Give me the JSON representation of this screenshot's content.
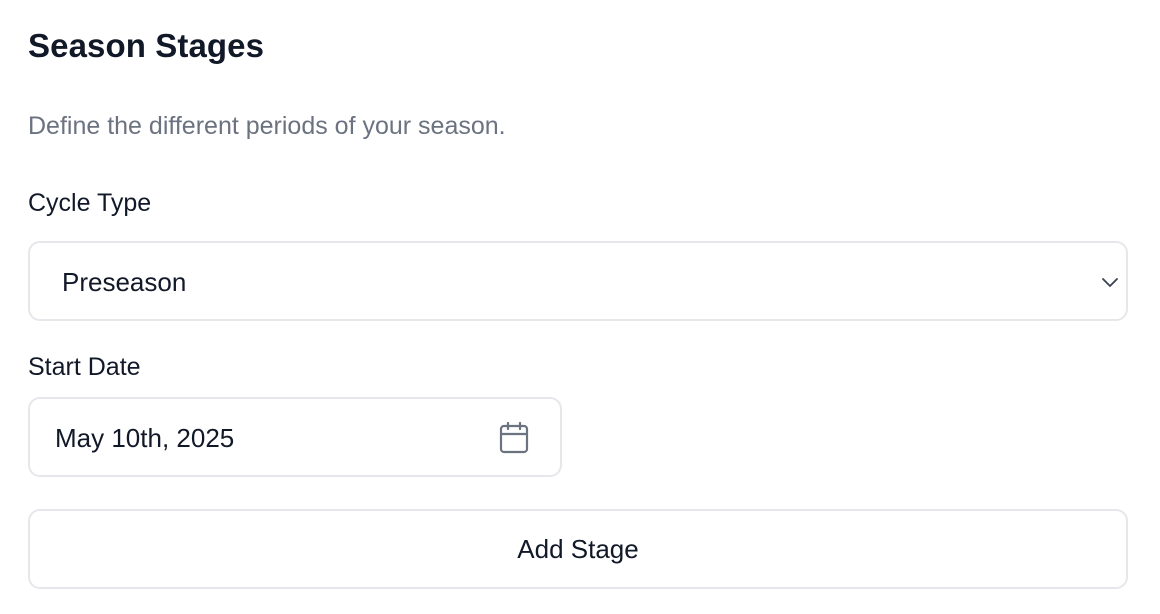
{
  "section": {
    "title": "Season Stages",
    "description": "Define the different periods of your season."
  },
  "cycle_type": {
    "label": "Cycle Type",
    "selected": "Preseason",
    "icon": "chevron-down-icon"
  },
  "start_date": {
    "label": "Start Date",
    "value": "May 10th, 2025",
    "icon": "calendar-icon"
  },
  "actions": {
    "add_stage_label": "Add Stage"
  },
  "colors": {
    "text_primary": "#111827",
    "text_muted": "#6b7280",
    "border": "#e5e7eb",
    "icon": "#6b7280"
  }
}
